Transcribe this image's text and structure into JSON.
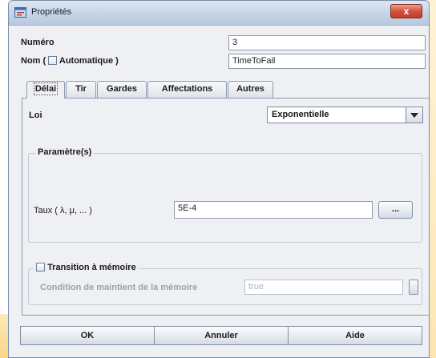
{
  "window": {
    "title": "Propriétés",
    "close_symbol": "x",
    "icon": "properties-app-icon"
  },
  "general": {
    "numero_label": "Numéro",
    "numero_value": "3",
    "nom_label_prefix": "Nom (",
    "nom_checkbox_label": "Automatique )",
    "nom_value": "TimeToFail"
  },
  "tabs": [
    {
      "label": "Délai",
      "active": true
    },
    {
      "label": "Tir",
      "active": false
    },
    {
      "label": "Gardes",
      "active": false
    },
    {
      "label": "Affectations",
      "active": false
    },
    {
      "label": "Autres",
      "active": false
    }
  ],
  "delai": {
    "loi_label": "Loi",
    "loi_value": "Exponentielle",
    "parametres_title": "Paramètre(s)",
    "taux_label": "Taux ( λ, μ, ... )",
    "taux_value": "5E-4",
    "taux_button": "..."
  },
  "memoire": {
    "checkbox_label": "Transition à mémoire",
    "condition_label": "Condition de maintient de la mémoire",
    "condition_value": "true"
  },
  "buttons": {
    "ok": "OK",
    "annuler": "Annuler",
    "aide": "Aide"
  }
}
